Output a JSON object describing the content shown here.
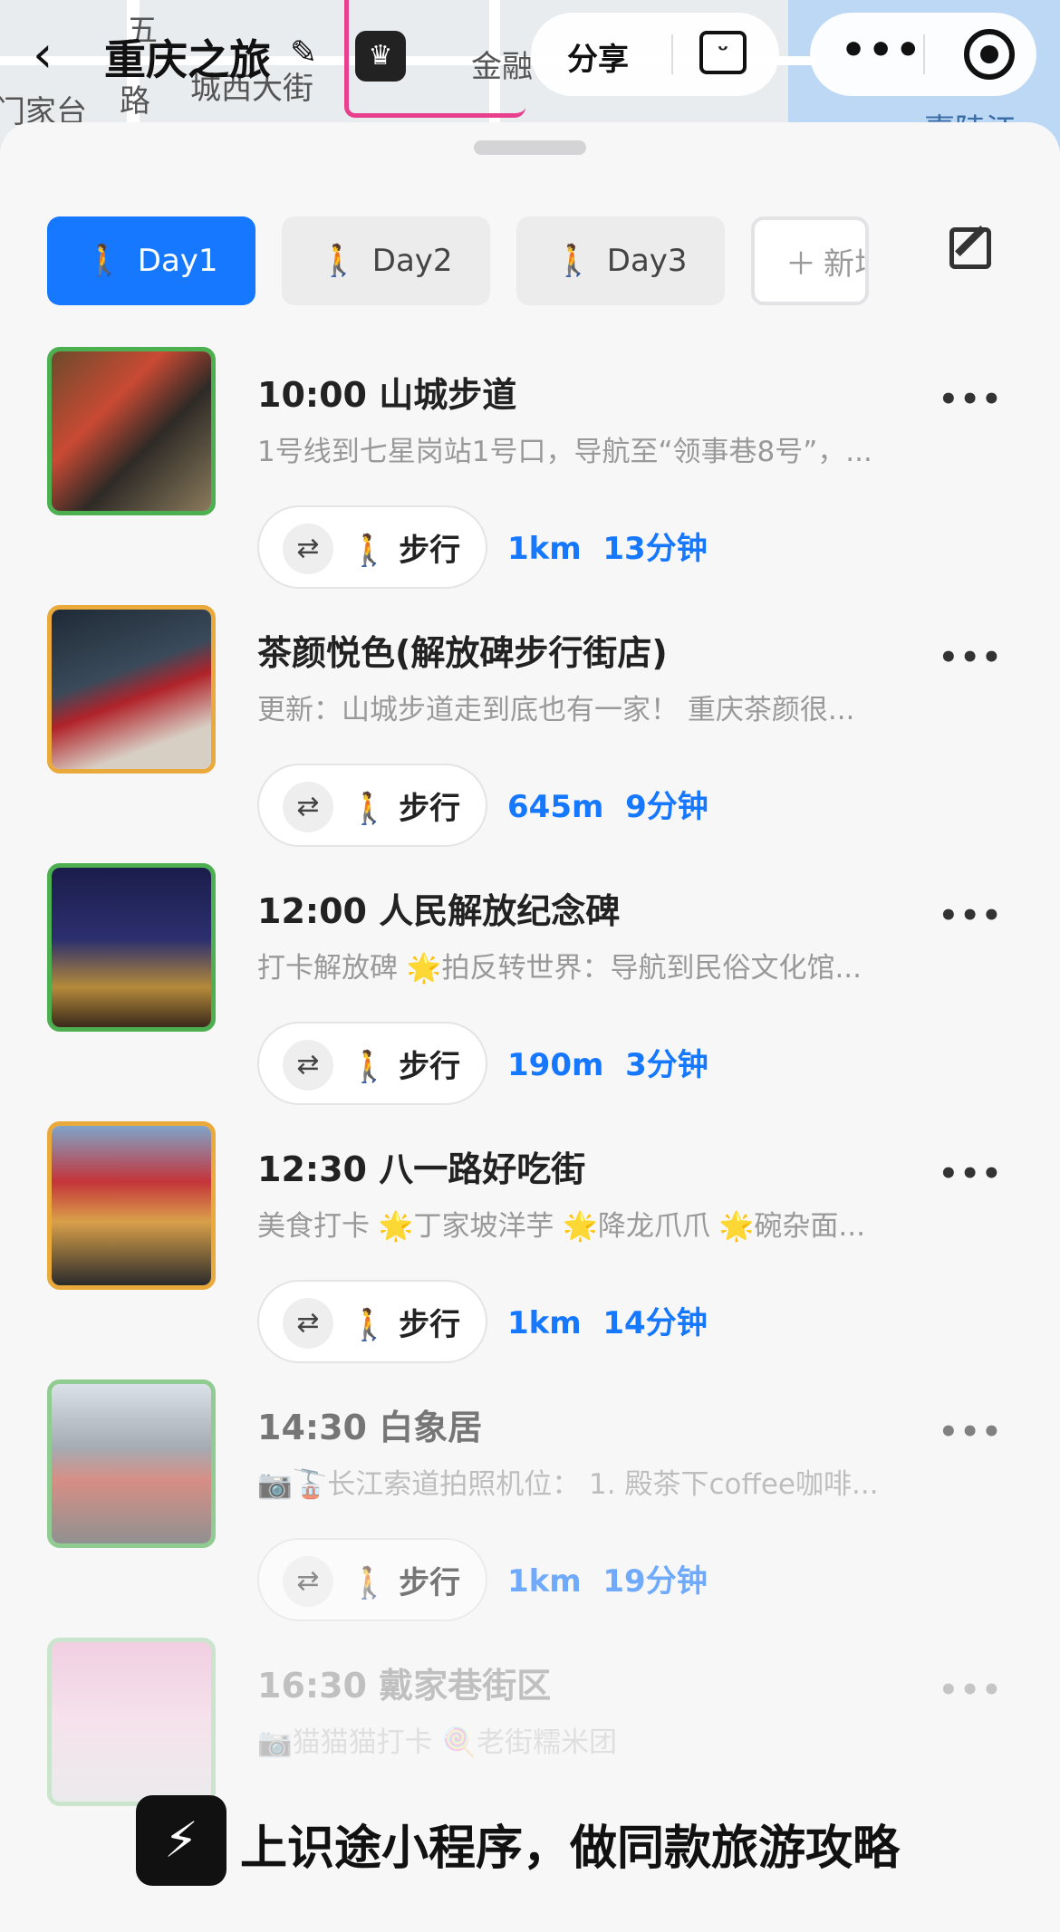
{
  "map": {
    "labels": [
      "五",
      "路",
      "城西大街",
      "门家台",
      "金融",
      "嘉陵江"
    ]
  },
  "header": {
    "back_icon": "‹",
    "title": "重庆之旅",
    "share_label": "分享"
  },
  "tabs": [
    {
      "label": "Day1"
    },
    {
      "label": "Day2"
    },
    {
      "label": "Day3"
    },
    {
      "label": "新增"
    }
  ],
  "items": [
    {
      "title": "10:00 山城步道",
      "desc": "1号线到七星岗站1号口，导航至“领事巷8号”，...",
      "mode": "步行",
      "distance": "1km",
      "duration": "13分钟"
    },
    {
      "title": "茶颜悦色(解放碑步行街店)",
      "desc": "更新：山城步道走到底也有一家！ 重庆茶颜很...",
      "mode": "步行",
      "distance": "645m",
      "duration": "9分钟"
    },
    {
      "title": "12:00 人民解放纪念碑",
      "desc": "打卡解放碑 🌟拍反转世界：导航到民俗文化馆...",
      "mode": "步行",
      "distance": "190m",
      "duration": "3分钟"
    },
    {
      "title": "12:30 八一路好吃街",
      "desc": "美食打卡 🌟丁家坡洋芋 🌟降龙爪爪 🌟碗杂面...",
      "mode": "步行",
      "distance": "1km",
      "duration": "14分钟"
    },
    {
      "title": "14:30 白象居",
      "desc": "📷🚡长江索道拍照机位： 1. 殿茶下coffee咖啡...",
      "mode": "步行",
      "distance": "1km",
      "duration": "19分钟"
    },
    {
      "title": "16:30 戴家巷街区",
      "desc": "📷猫猫猫打卡 🍭老街糯米团"
    }
  ],
  "banner": {
    "text": "上识途小程序，做同款旅游攻略"
  },
  "colors": {
    "accent": "#1677ff",
    "green_border": "#4caf50",
    "orange_border": "#e9a93b"
  }
}
